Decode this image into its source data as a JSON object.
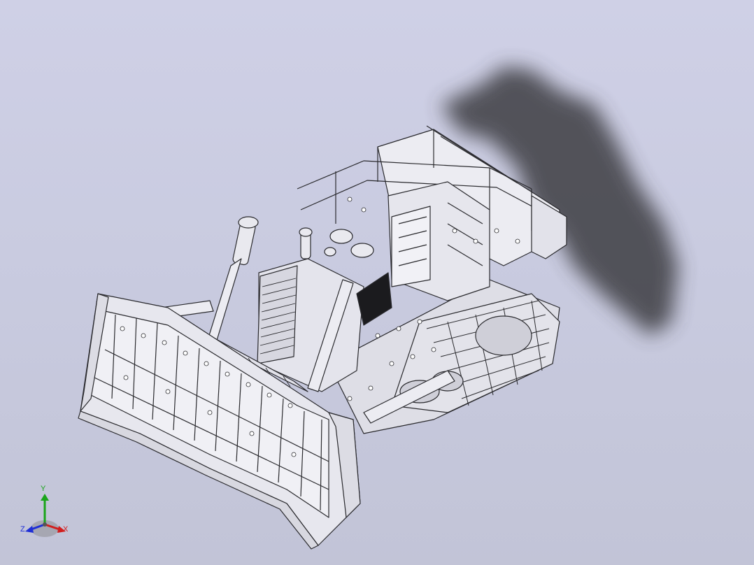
{
  "viewport": {
    "background_top": "#cfd0e6",
    "background_bottom": "#c2c4d7"
  },
  "model": {
    "line_color": "#2a2a2e",
    "face_color": "#e9e9ef",
    "shadow_color": "#3c3c42"
  },
  "triad": {
    "x_label": "X",
    "y_label": "Y",
    "z_label": "Z",
    "x_color": "#d21e1e",
    "y_color": "#1aa51a",
    "z_color": "#1f2fd6"
  }
}
